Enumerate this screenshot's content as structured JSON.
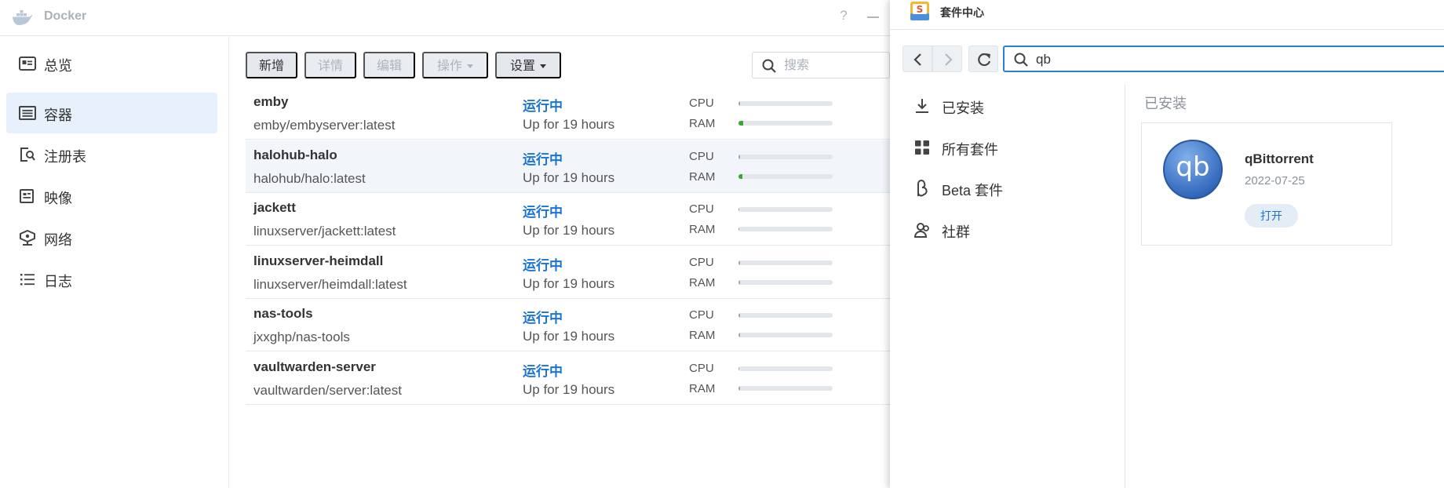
{
  "docker": {
    "title": "Docker",
    "help": "?",
    "sidebar": [
      {
        "label": "总览",
        "icon": "dashboard-icon",
        "active": false
      },
      {
        "label": "容器",
        "icon": "container-icon",
        "active": true
      },
      {
        "label": "注册表",
        "icon": "registry-search-icon",
        "active": false
      },
      {
        "label": "映像",
        "icon": "image-icon",
        "active": false
      },
      {
        "label": "网络",
        "icon": "network-icon",
        "active": false
      },
      {
        "label": "日志",
        "icon": "log-list-icon",
        "active": false
      }
    ],
    "toolbar": {
      "add": "新增",
      "detail": "详情",
      "edit": "编辑",
      "action": "操作",
      "settings": "设置"
    },
    "search": {
      "placeholder": "搜索"
    },
    "cpu_label": "CPU",
    "ram_label": "RAM",
    "containers": [
      {
        "name": "emby",
        "image": "emby/embyserver:latest",
        "status": "运行中",
        "uptime": "Up for 19 hours",
        "cpu": 0.01,
        "ram": 0.05,
        "ram_color": "#36a82e"
      },
      {
        "name": "halohub-halo",
        "image": "halohub/halo:latest",
        "status": "运行中",
        "uptime": "Up for 19 hours",
        "cpu": 0.01,
        "ram": 0.04,
        "ram_color": "#36a82e"
      },
      {
        "name": "jackett",
        "image": "linuxserver/jackett:latest",
        "status": "运行中",
        "uptime": "Up for 19 hours",
        "cpu": 0.0,
        "ram": 0.0,
        "ram_color": "#9aa3ad"
      },
      {
        "name": "linuxserver-heimdall",
        "image": "linuxserver/heimdall:latest",
        "status": "运行中",
        "uptime": "Up for 19 hours",
        "cpu": 0.01,
        "ram": 0.01,
        "ram_color": "#9aa3ad"
      },
      {
        "name": "nas-tools",
        "image": "jxxghp/nas-tools",
        "status": "运行中",
        "uptime": "Up for 19 hours",
        "cpu": 0.01,
        "ram": 0.01,
        "ram_color": "#9aa3ad"
      },
      {
        "name": "vaultwarden-server",
        "image": "vaultwarden/server:latest",
        "status": "运行中",
        "uptime": "Up for 19 hours",
        "cpu": 0.0,
        "ram": 0.01,
        "ram_color": "#9aa3ad"
      }
    ]
  },
  "package_center": {
    "title": "套件中心",
    "search_value": "qb",
    "nav": [
      {
        "label": "已安装",
        "icon": "download-icon"
      },
      {
        "label": "所有套件",
        "icon": "grid-icon"
      },
      {
        "label": "Beta 套件",
        "icon": "beta-icon"
      },
      {
        "label": "社群",
        "icon": "community-icon"
      }
    ],
    "section_title": "已安装",
    "app": {
      "name": "qBittorrent",
      "date": "2022-07-25",
      "open": "打开",
      "icon_text": "qb"
    }
  },
  "colors": {
    "accent": "#1a73d8",
    "running": "#1a73d8",
    "bar_bg": "#e3e7ec"
  }
}
